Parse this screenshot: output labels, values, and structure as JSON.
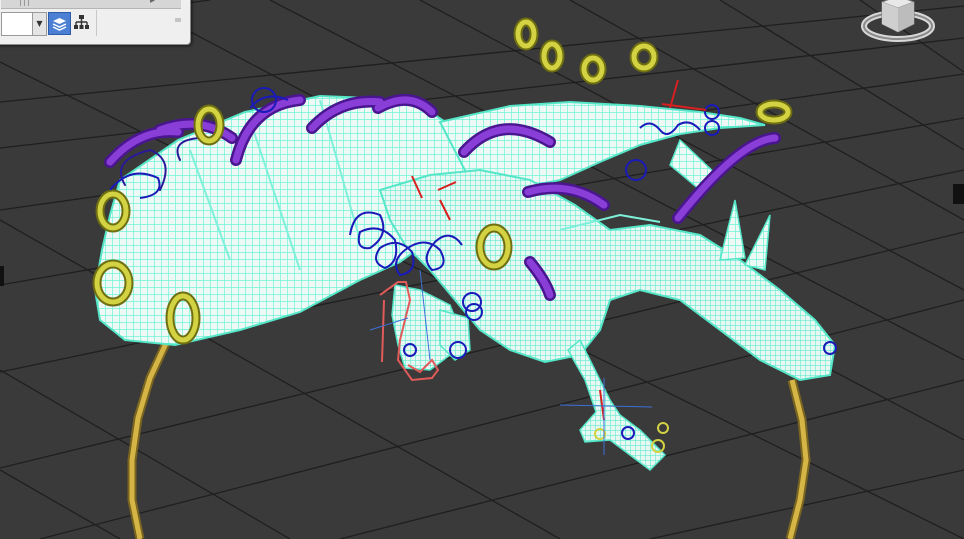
{
  "app": {
    "type": "3D viewport",
    "background_color": "#3a3a3a",
    "grid_color": "#202020"
  },
  "scene": {
    "mesh_wire_color": "#6ff4d8",
    "mesh_fill_color": "#e6f7f2",
    "ik_control_color": "#1414b4",
    "ring_yellow_color": "#c9c93a",
    "ring_purple_color": "#7a2ecf",
    "base_ring_color": "#c8a83a",
    "bone_color": "#d82020",
    "selection_color": "#e05050"
  },
  "toolbar": {
    "icons": {
      "dropdown": "chevron-down-icon",
      "layers": "layers-icon",
      "hierarchy": "hierarchy-icon"
    }
  },
  "viewcube": {
    "icon": "viewcube-icon"
  }
}
